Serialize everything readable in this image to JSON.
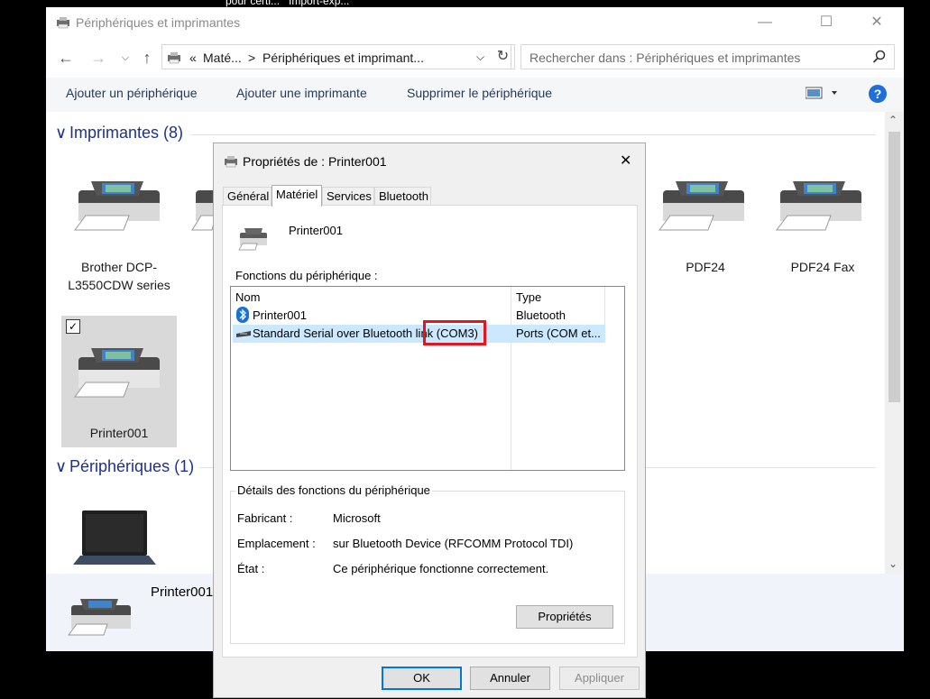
{
  "background_title": "pour certi...   Import-exp...",
  "window": {
    "title": "Périphériques et imprimantes",
    "minimize": "—",
    "maximize": "☐",
    "close": "✕"
  },
  "address": {
    "chevrons": "«",
    "crumb1": "Maté...",
    "sep": ">",
    "crumb2": "Périphériques et imprimant...",
    "dropdown": "⌵",
    "refresh": "↻"
  },
  "search": {
    "placeholder": "Rechercher dans : Périphériques et imprimantes"
  },
  "commands": {
    "add_device": "Ajouter un périphérique",
    "add_printer": "Ajouter une imprimante",
    "remove_device": "Supprimer le périphérique",
    "help": "?"
  },
  "groups": {
    "printers": {
      "chevron": "∨",
      "label": "Imprimantes (8)"
    },
    "devices": {
      "chevron": "∨",
      "label": "Périphériques (1)"
    }
  },
  "printers": [
    {
      "name": "Brother DCP-L3550CDW series"
    },
    {
      "name": "PDF24"
    },
    {
      "name": "PDF24 Fax"
    },
    {
      "name": "Printer001"
    }
  ],
  "details_pane": {
    "name": "Printer001"
  },
  "dialog": {
    "title": "Propriétés de : Printer001",
    "close": "✕",
    "tabs": [
      "Général",
      "Matériel",
      "Services",
      "Bluetooth"
    ],
    "device_name": "Printer001",
    "functions_label": "Fonctions du périphérique :",
    "columns": {
      "name": "Nom",
      "type": "Type"
    },
    "rows": [
      {
        "name": "Printer001",
        "type": "Bluetooth"
      },
      {
        "name": "Standard Serial over Bluetooth link (COM3)",
        "type": "Ports (COM et..."
      }
    ],
    "details_legend": "Détails des fonctions du périphérique",
    "fields": [
      {
        "label": "Fabricant :",
        "value": "Microsoft"
      },
      {
        "label": "Emplacement :",
        "value": "sur Bluetooth Device (RFCOMM Protocol TDI)"
      },
      {
        "label": "État :",
        "value": "Ce périphérique fonctionne correctement."
      }
    ],
    "properties_button": "Propriétés",
    "ok": "OK",
    "cancel": "Annuler",
    "apply": "Appliquer"
  }
}
